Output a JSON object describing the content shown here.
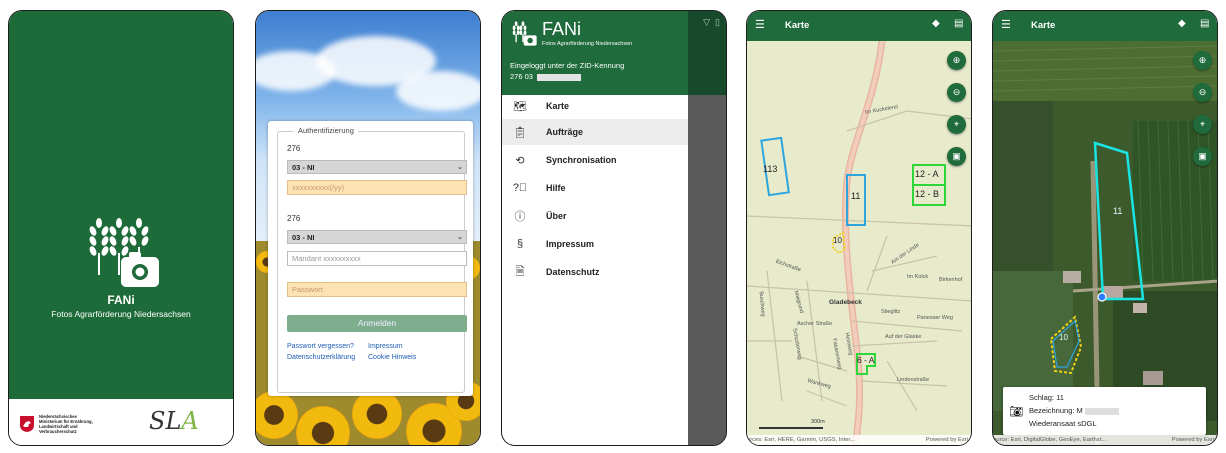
{
  "screen1": {
    "app_name": "FANi",
    "app_subtitle": "Fotos Agrarförderung Niedersachsen",
    "ministry_text": "Niedersächsisches Ministerium für Ernährung, Landwirtschaft und Verbraucherschutz",
    "partner_logo": "SLA",
    "colors": {
      "brand_green": "#1e6b3a"
    },
    "icons": [
      "wheat-icon",
      "camera-icon",
      "lower-saxony-horse-icon"
    ]
  },
  "screen2": {
    "legend": "Authentifizierung",
    "label1": "276",
    "select1": "03 - NI",
    "input1_placeholder": "xxxxxxxxxx(/yy)",
    "label2": "276",
    "select2": "03 - NI",
    "input2_placeholder": "Mandant xxxxxxxxxx",
    "password_placeholder": "Passwort",
    "login_button": "Anmelden",
    "link_forgot": "Passwort vergessen?",
    "link_impressum": "Impressum",
    "link_privacy": "Datenschutzerklärung",
    "link_cookie": "Cookie Hinweis"
  },
  "screen3": {
    "title": "FANi",
    "subtitle": "Fotos Agrarförderung Niedersachsen",
    "login_line": "Eingeloggt unter der ZID-Kennung",
    "login_id": "276 03",
    "menu": [
      {
        "label": "Karte",
        "icon": "map-icon"
      },
      {
        "label": "Aufträge",
        "icon": "clipboard-icon"
      },
      {
        "label": "Synchronisation",
        "icon": "sync-icon"
      },
      {
        "label": "Hilfe",
        "icon": "help-icon"
      },
      {
        "label": "Über",
        "icon": "info-icon"
      },
      {
        "label": "Impressum",
        "icon": "section-icon"
      },
      {
        "label": "Datenschutz",
        "icon": "document-icon"
      }
    ]
  },
  "screen4": {
    "title": "Karte",
    "parcels": [
      "113",
      "11",
      "12 - A",
      "12 - B",
      "10",
      "6 - A"
    ],
    "place_labels": [
      "Gladebeck",
      "Im Kolck",
      "Birkenhof",
      "Am der Linde",
      "Stieglitz",
      "Panesser Weg",
      "Auf der Glaske",
      "Ascher Straße",
      "Lindenstraße",
      "Wankweg",
      "Eichstraße",
      "Im Kuckelerei",
      "Buschweg",
      "Maigrund",
      "Schusterweg",
      "Fasanenweg",
      "Heimweg"
    ],
    "scale_label": "300m",
    "attribution": "urces: Esri, HERE, Garmin, USGS, Inter...",
    "powered": "Powered by Esri"
  },
  "screen5": {
    "title": "Karte",
    "parcels": [
      "11",
      "10"
    ],
    "info_schlag": "Schlag: 11",
    "info_bezeichnung": "Bezeichnung: M",
    "info_note": "Wiederansaat sDGL",
    "attribution": "ource: Esri, DigitalGlobe, GeoEye, Earthst...",
    "powered": "Powered by Esri"
  }
}
